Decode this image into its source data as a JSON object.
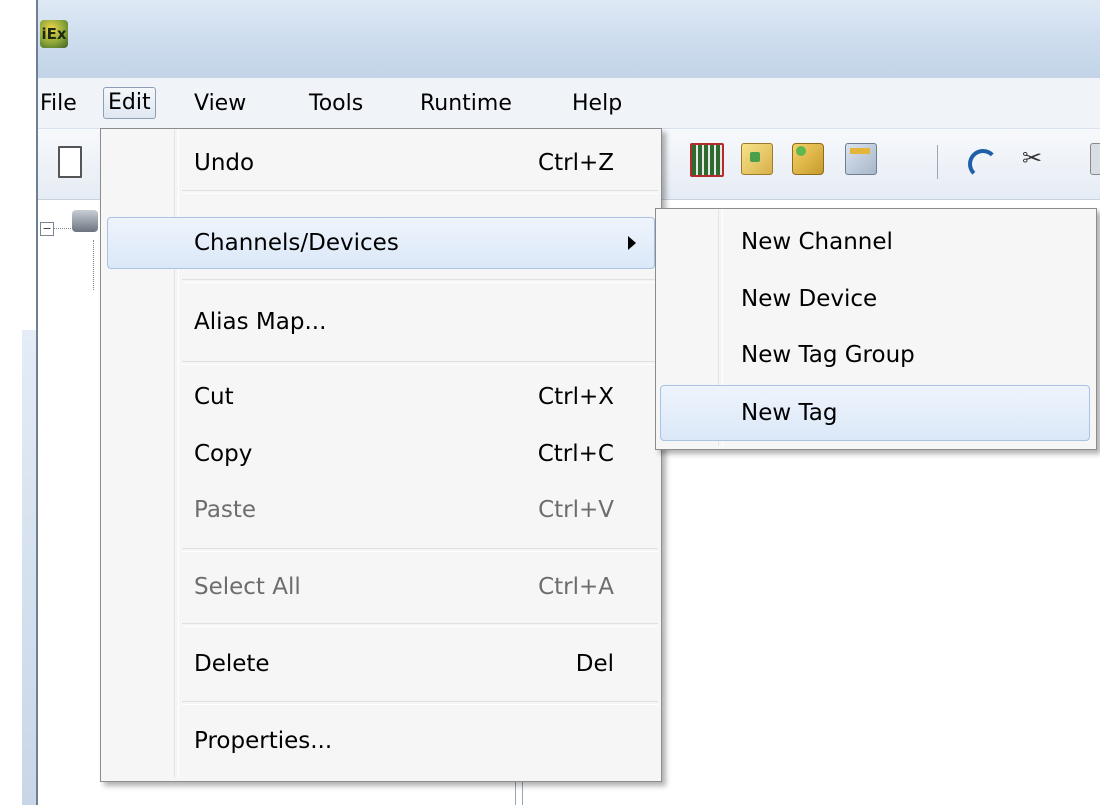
{
  "menubar": {
    "items": [
      "File",
      "Edit",
      "View",
      "Tools",
      "Runtime",
      "Help"
    ]
  },
  "app": {
    "icon_text": "iEx"
  },
  "edit_menu": {
    "items": [
      {
        "label": "Undo",
        "shortcut": "Ctrl+Z"
      },
      {
        "label": "Channels/Devices",
        "shortcut": ""
      },
      {
        "label": "Alias Map...",
        "shortcut": ""
      },
      {
        "label": "Cut",
        "shortcut": "Ctrl+X"
      },
      {
        "label": "Copy",
        "shortcut": "Ctrl+C"
      },
      {
        "label": "Paste",
        "shortcut": "Ctrl+V"
      },
      {
        "label": "Select All",
        "shortcut": "Ctrl+A"
      },
      {
        "label": "Delete",
        "shortcut": "Del"
      },
      {
        "label": "Properties...",
        "shortcut": ""
      }
    ]
  },
  "channels_submenu": {
    "items": [
      {
        "label": "New Channel"
      },
      {
        "label": "New Device"
      },
      {
        "label": "New Tag Group"
      },
      {
        "label": "New Tag"
      }
    ]
  },
  "colors": {
    "highlight": "#dbe8f8",
    "highlight_border": "#a8c3e6",
    "disabled_text": "#6d6d6d",
    "menu_bg": "#f6f6f6"
  },
  "icons": [
    "new-file-icon",
    "channel-icon",
    "device-icon",
    "tag-group-icon",
    "properties-icon",
    "undo-icon",
    "cut-icon",
    "copy-icon",
    "tree-expander-icon",
    "server-node-icon",
    "app-icon",
    "submenu-arrow-icon"
  ]
}
